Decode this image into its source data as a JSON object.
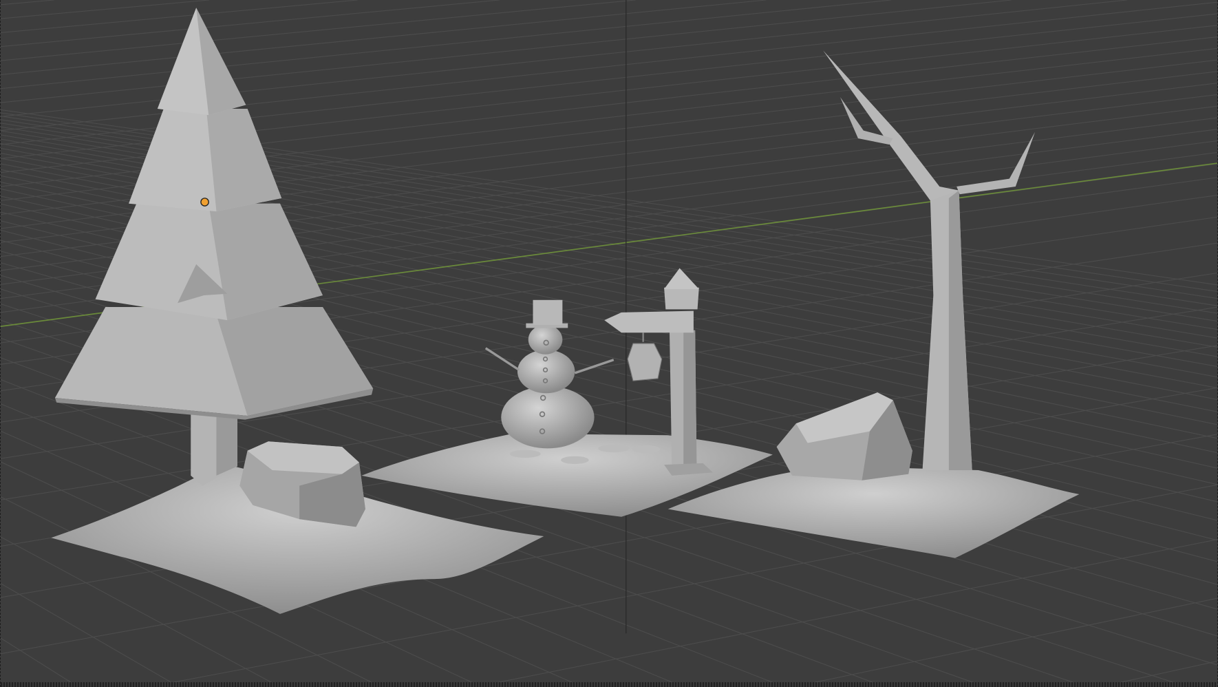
{
  "viewport": {
    "kind": "3d-viewport",
    "colors": {
      "background": "#3d3d3d",
      "grid": "#4c4c4c",
      "x_axis": "#6a8a3a",
      "y_axis": "#2e2e2e",
      "mesh_light": "#c4c4c4",
      "mesh_mid": "#a8a8a8",
      "mesh_dark": "#8a8a8a",
      "origin": "#f0a030"
    },
    "objects": [
      "pine-tree",
      "rock",
      "snow-mound",
      "snowman",
      "lamp-post",
      "dead-tree"
    ],
    "icons": {
      "origin": "object-origin-icon"
    }
  }
}
